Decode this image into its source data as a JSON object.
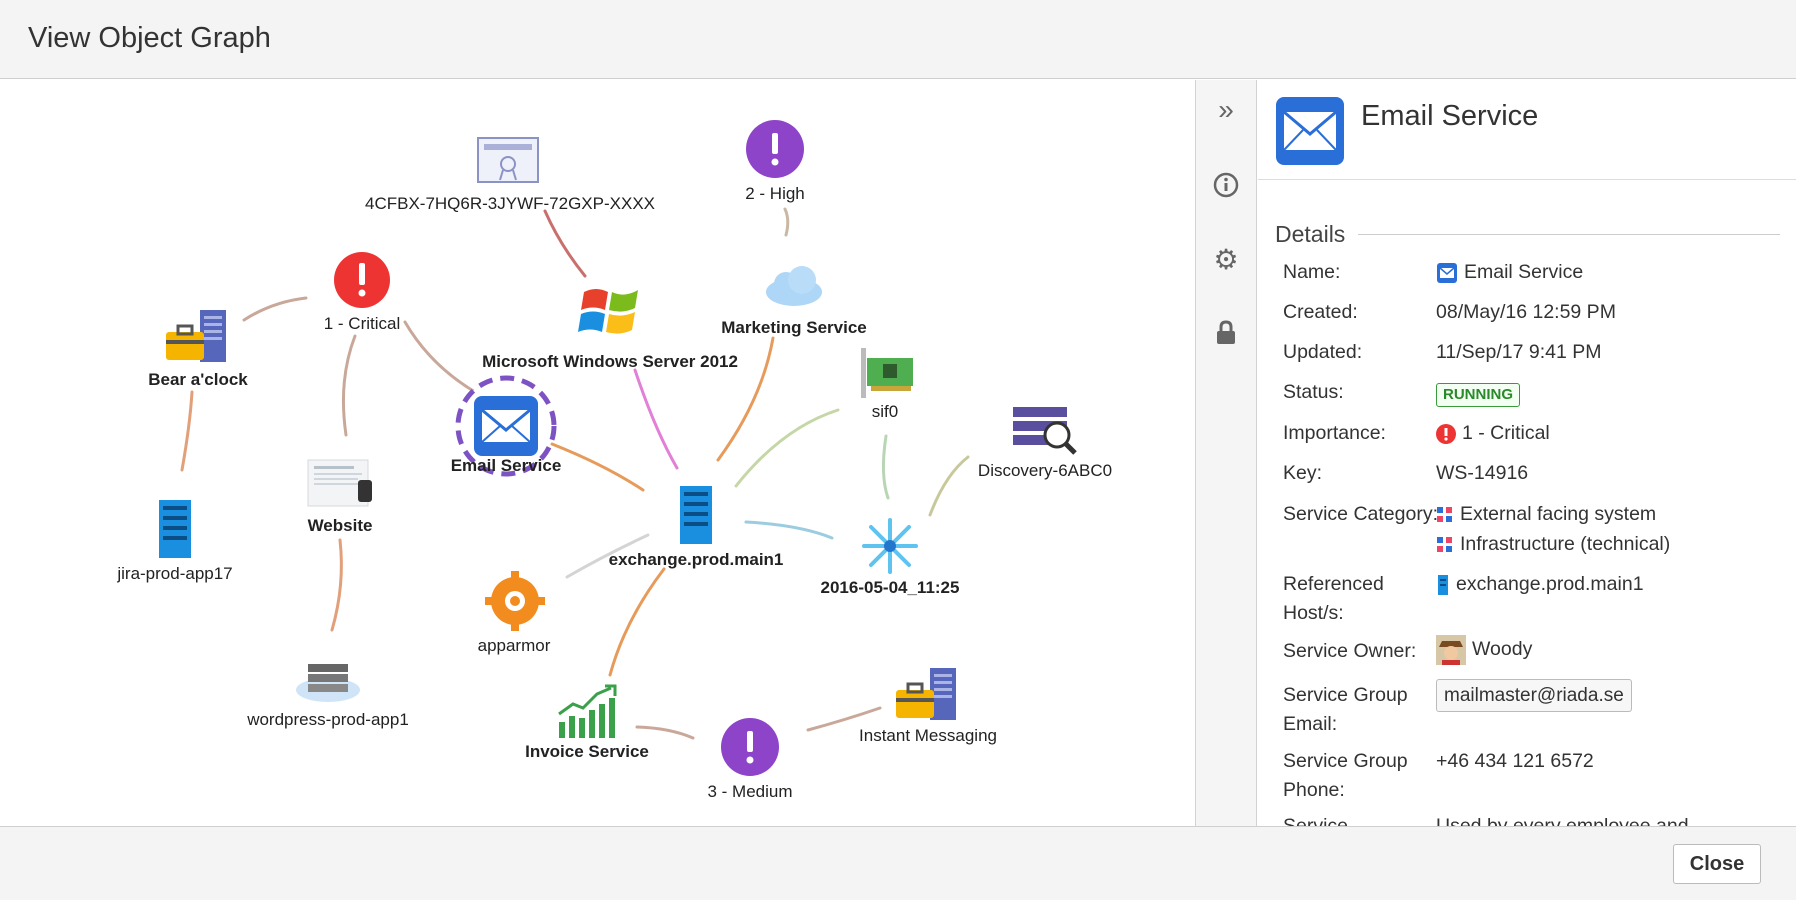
{
  "dialog": {
    "title": "View Object Graph",
    "close_label": "Close"
  },
  "graph": {
    "nodes": {
      "license": {
        "label": "4CFBX-7HQ6R-3JYWF-72GXP-XXXX",
        "icon": "certificate-icon"
      },
      "high": {
        "label": "2 - High",
        "icon": "priority-high-icon"
      },
      "critical": {
        "label": "1 - Critical",
        "icon": "critical-alert-icon"
      },
      "bear": {
        "label": "Bear a'clock",
        "icon": "briefcase-building-icon"
      },
      "windows": {
        "label": "Microsoft Windows Server 2012",
        "icon": "windows-logo-icon"
      },
      "marketing": {
        "label": "Marketing Service",
        "icon": "cloud-icon"
      },
      "sif0": {
        "label": "sif0",
        "icon": "network-card-icon"
      },
      "discovery": {
        "label": "Discovery-6ABC0",
        "icon": "discovery-search-icon"
      },
      "email": {
        "label": "Email Service",
        "icon": "envelope-icon"
      },
      "jira": {
        "label": "jira-prod-app17",
        "icon": "server-icon"
      },
      "website": {
        "label": "Website",
        "icon": "website-screenshot-icon"
      },
      "exchange": {
        "label": "exchange.prod.main1",
        "icon": "server-icon"
      },
      "scan": {
        "label": "2016-05-04_11:25",
        "icon": "scan-burst-icon"
      },
      "apparmor": {
        "label": "apparmor",
        "icon": "gear-package-icon"
      },
      "wordpress": {
        "label": "wordpress-prod-app1",
        "icon": "cloud-server-icon"
      },
      "invoice": {
        "label": "Invoice Service",
        "icon": "growth-chart-icon"
      },
      "medium": {
        "label": "3 - Medium",
        "icon": "priority-medium-icon"
      },
      "im": {
        "label": "Instant Messaging",
        "icon": "briefcase-building-icon"
      }
    }
  },
  "toolbar": {
    "items": [
      {
        "name": "collapse",
        "icon": "double-chevron-right-icon",
        "glyph": "»"
      },
      {
        "name": "info",
        "icon": "info-icon",
        "glyph": "ⓘ"
      },
      {
        "name": "settings",
        "icon": "gear-icon",
        "glyph": "⚙"
      },
      {
        "name": "lock",
        "icon": "lock-icon",
        "glyph": "🔒"
      }
    ]
  },
  "details": {
    "title": "Email Service",
    "section": "Details",
    "rows": {
      "name": {
        "label": "Name:",
        "value": "Email Service"
      },
      "created": {
        "label": "Created:",
        "value": "08/May/16 12:59 PM"
      },
      "updated": {
        "label": "Updated:",
        "value": "11/Sep/17 9:41 PM"
      },
      "status": {
        "label": "Status:",
        "value": "RUNNING"
      },
      "importance": {
        "label": "Importance:",
        "value": "1 - Critical"
      },
      "key": {
        "label": "Key:",
        "value": "WS-14916"
      },
      "category": {
        "label": "Service Category:",
        "values": [
          "External facing system",
          "Infrastructure (technical)"
        ]
      },
      "hosts": {
        "label_line1": "Referenced",
        "label_line2": "Host/s:",
        "value": "exchange.prod.main1"
      },
      "owner": {
        "label": "Service Owner:",
        "value": "Woody"
      },
      "group_email": {
        "label_line1": "Service Group",
        "label_line2": "Email:",
        "value": "mailmaster@riada.se"
      },
      "group_phone": {
        "label_line1": "Service Group",
        "label_line2": "Phone:",
        "value": "+46 434 121 6572"
      },
      "truncated": {
        "label": "Service",
        "value": "Used by every employee and"
      }
    }
  },
  "colors": {
    "critical": "#ee3333",
    "priority": "#8e44c9",
    "accent_blue": "#2a6ed8",
    "status_green": "#2a8a2a"
  }
}
